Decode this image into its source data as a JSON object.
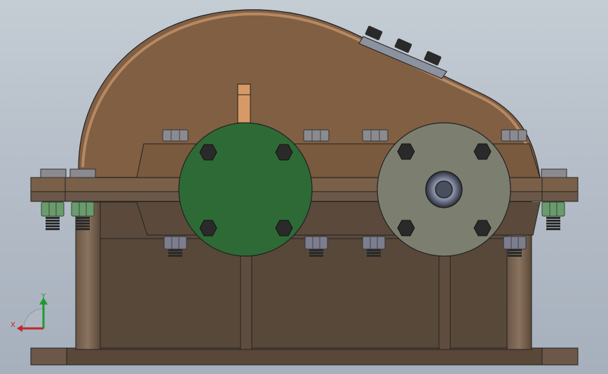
{
  "viewport": {
    "name": "3d-model-viewport",
    "model": "gearbox-reducer-front-view"
  },
  "colors": {
    "background_top": "#c4ccd4",
    "background_bottom": "#a6b0bc",
    "cover": "#805f43",
    "cover_edge": "#bf8f66",
    "base": "#5b4a3c",
    "base_dark": "#4c3f34",
    "green_cap": "#2e6a35",
    "gray_cap": "#7c7f70",
    "bolt": "#2a2a2a",
    "nut": "#828287",
    "washer_green": "#6c9a6e",
    "axis_x": "#c1272d",
    "axis_y": "#1e9b2e"
  },
  "triad": {
    "x_label": "X",
    "y_label": "Y"
  }
}
